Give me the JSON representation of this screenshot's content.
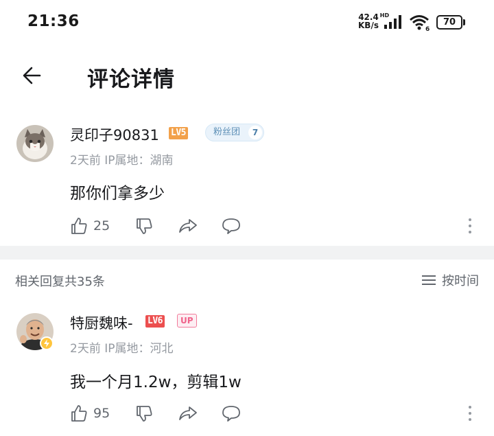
{
  "status_bar": {
    "time": "21:36",
    "net_speed_value": "42.4",
    "net_speed_unit": "KB/s",
    "net_type": "HD",
    "wifi_label": "6",
    "battery": "70"
  },
  "header": {
    "title": "评论详情",
    "back_icon": "arrow-left-icon"
  },
  "main_comment": {
    "username": "灵印子90831",
    "level": "LV5",
    "fan_badge": "粉丝团",
    "fan_level": "7",
    "meta": "2天前 IP属地：湖南",
    "text": "那你们拿多少",
    "likes": "25"
  },
  "replies": {
    "count_label": "相关回复共35条",
    "sort_label": "按时间"
  },
  "reply_comment": {
    "username": "特厨魏味-",
    "level": "LV6",
    "up_badge": "UP",
    "meta": "2天前 IP属地：河北",
    "text": "我一个月1.2w，剪辑1w",
    "likes": "95"
  },
  "colors": {
    "level5": "#f2a14a",
    "level6": "#ec4f4f",
    "up_pink": "#f0628a",
    "fan_blue": "#5d8fb6",
    "secondary_text": "#9499a0"
  }
}
